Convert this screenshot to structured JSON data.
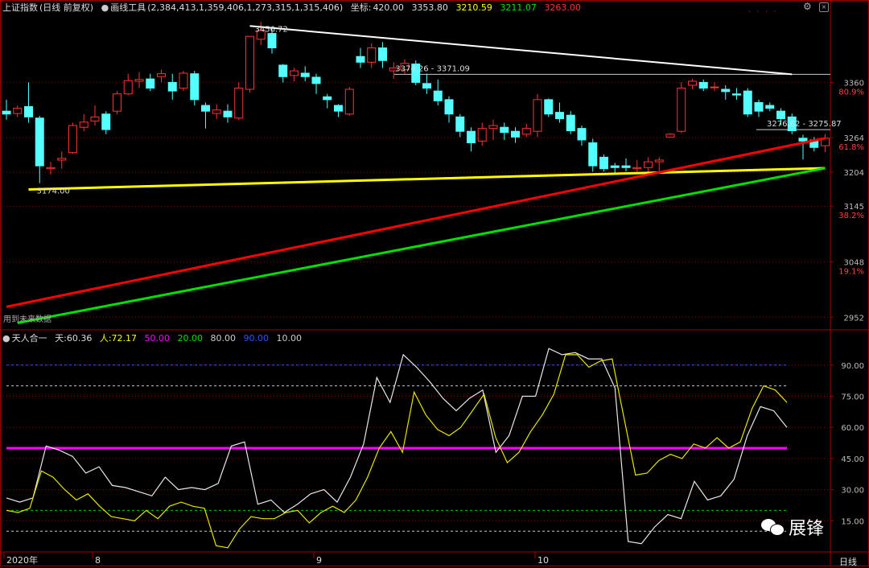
{
  "header": {
    "index_name": "上证指数",
    "index_mode": "(日线 前复权)",
    "tool_label": "画线工具",
    "tool_values": "(2,384,413,1,359,406,1,273,315,1,315,406)",
    "coord_label": "坐标:",
    "coord_value": "420.00",
    "v1": "3353.80",
    "v2": "3210.59",
    "v3": "3211.07",
    "v4": "3263.00"
  },
  "indicator_header": {
    "name": "天人合一",
    "tian_label": "天:",
    "tian_value": "60.36",
    "ren_label": "人:",
    "ren_value": "72.17",
    "l50": "50.00",
    "l20": "20.00",
    "l80": "80.00",
    "l90": "90.00",
    "l10": "10.00"
  },
  "annotations": {
    "high_label": "3456.72",
    "low_label": "3174.00",
    "white_line_label": "3374.26 - 3371.09",
    "red_line_label": "3276.62 - 3275.87",
    "future_label": "用到未来数据",
    "watermark": "展锋",
    "period": "日线"
  },
  "x_labels": [
    {
      "text": "2020年",
      "bar": 0
    },
    {
      "text": "8",
      "bar": 8
    },
    {
      "text": "9",
      "bar": 28
    },
    {
      "text": "10",
      "bar": 48
    }
  ],
  "colors": {
    "up": "#ff3232",
    "down": "#54ffff",
    "white_line": "#ffffff",
    "yellow_line": "#ffff00",
    "red_line": "#ff0000",
    "green_line": "#00e000",
    "magenta": "#ff00ff"
  },
  "chart_data": [
    {
      "type": "candlestick",
      "title": "上证指数",
      "y_ticks": [
        {
          "value": 3360,
          "label": "3360",
          "fib": "80.9%"
        },
        {
          "value": 3264,
          "label": "3264",
          "fib": "61.8%"
        },
        {
          "value": 3204,
          "label": "3204",
          "fib": ""
        },
        {
          "value": 3145,
          "label": "3145",
          "fib": "38.2%"
        },
        {
          "value": 3048,
          "label": "3048",
          "fib": "19.1%"
        },
        {
          "value": 2952,
          "label": "2952",
          "fib": ""
        }
      ],
      "ylim": [
        2930,
        3478
      ],
      "candles": [
        [
          3310,
          3305,
          3330,
          3295
        ],
        [
          3306,
          3315,
          3320,
          3300
        ],
        [
          3318,
          3300,
          3360,
          3290
        ],
        [
          3298,
          3215,
          3302,
          3185
        ],
        [
          3210,
          3212,
          3222,
          3200
        ],
        [
          3225,
          3228,
          3240,
          3210
        ],
        [
          3238,
          3285,
          3290,
          3236
        ],
        [
          3282,
          3291,
          3305,
          3275
        ],
        [
          3293,
          3300,
          3320,
          3285
        ],
        [
          3305,
          3278,
          3310,
          3270
        ],
        [
          3310,
          3340,
          3345,
          3305
        ],
        [
          3340,
          3363,
          3375,
          3338
        ],
        [
          3362,
          3365,
          3378,
          3350
        ],
        [
          3366,
          3350,
          3375,
          3345
        ],
        [
          3370,
          3375,
          3382,
          3360
        ],
        [
          3360,
          3345,
          3375,
          3330
        ],
        [
          3350,
          3376,
          3380,
          3345
        ],
        [
          3375,
          3330,
          3380,
          3320
        ],
        [
          3320,
          3310,
          3325,
          3280
        ],
        [
          3306,
          3312,
          3322,
          3296
        ],
        [
          3310,
          3300,
          3322,
          3290
        ],
        [
          3298,
          3350,
          3360,
          3295
        ],
        [
          3348,
          3440,
          3440,
          3342
        ],
        [
          3435,
          3450,
          3465,
          3425
        ],
        [
          3445,
          3420,
          3456,
          3410
        ],
        [
          3390,
          3370,
          3392,
          3360
        ],
        [
          3372,
          3380,
          3385,
          3362
        ],
        [
          3376,
          3370,
          3388,
          3362
        ],
        [
          3369,
          3358,
          3375,
          3340
        ],
        [
          3335,
          3330,
          3340,
          3315
        ],
        [
          3320,
          3310,
          3322,
          3300
        ],
        [
          3305,
          3348,
          3352,
          3302
        ],
        [
          3405,
          3395,
          3420,
          3385
        ],
        [
          3395,
          3420,
          3428,
          3385
        ],
        [
          3420,
          3398,
          3430,
          3385
        ],
        [
          3380,
          3385,
          3395,
          3366
        ],
        [
          3382,
          3393,
          3400,
          3375
        ],
        [
          3392,
          3360,
          3398,
          3355
        ],
        [
          3358,
          3350,
          3375,
          3340
        ],
        [
          3345,
          3328,
          3365,
          3320
        ],
        [
          3330,
          3305,
          3336,
          3290
        ],
        [
          3300,
          3275,
          3305,
          3265
        ],
        [
          3275,
          3255,
          3282,
          3240
        ],
        [
          3258,
          3280,
          3290,
          3250
        ],
        [
          3280,
          3285,
          3295,
          3260
        ],
        [
          3282,
          3273,
          3290,
          3260
        ],
        [
          3275,
          3265,
          3282,
          3255
        ],
        [
          3270,
          3280,
          3288,
          3265
        ],
        [
          3275,
          3330,
          3340,
          3265
        ],
        [
          3330,
          3305,
          3332,
          3300
        ],
        [
          3308,
          3297,
          3325,
          3290
        ],
        [
          3303,
          3276,
          3310,
          3270
        ],
        [
          3280,
          3260,
          3285,
          3250
        ],
        [
          3255,
          3215,
          3262,
          3205
        ],
        [
          3230,
          3210,
          3235,
          3205
        ],
        [
          3215,
          3212,
          3220,
          3200
        ],
        [
          3215,
          3212,
          3228,
          3205
        ],
        [
          3210,
          3212,
          3225,
          3205
        ],
        [
          3212,
          3222,
          3230,
          3200
        ],
        [
          3222,
          3225,
          3230,
          3205
        ],
        [
          3265,
          3270,
          3272,
          3264
        ],
        [
          3275,
          3350,
          3360,
          3272
        ],
        [
          3355,
          3362,
          3366,
          3348
        ],
        [
          3360,
          3350,
          3365,
          3345
        ],
        [
          3352,
          3352,
          3360,
          3345
        ],
        [
          3348,
          3344,
          3355,
          3330
        ],
        [
          3340,
          3338,
          3350,
          3330
        ],
        [
          3345,
          3305,
          3350,
          3300
        ],
        [
          3325,
          3310,
          3330,
          3300
        ],
        [
          3320,
          3315,
          3325,
          3310
        ],
        [
          3310,
          3297,
          3315,
          3285
        ],
        [
          3300,
          3276,
          3306,
          3270
        ],
        [
          3263,
          3258,
          3269,
          3226
        ],
        [
          3260,
          3247,
          3265,
          3240
        ],
        [
          3250,
          3263,
          3270,
          3239
        ]
      ],
      "lines": [
        {
          "name": "white",
          "points": [
            [
              3458,
              22
            ],
            [
              3374,
              71
            ]
          ]
        },
        {
          "name": "yellow",
          "points": [
            [
              3174,
              2
            ],
            [
              3211,
              74
            ]
          ]
        },
        {
          "name": "red",
          "points": [
            [
              2970,
              0
            ],
            [
              3263,
              74
            ]
          ]
        },
        {
          "name": "green",
          "points": [
            [
              2942,
              1
            ],
            [
              3211,
              74
            ]
          ]
        }
      ]
    },
    {
      "type": "line",
      "title": "天人合一",
      "y_ticks": [
        90,
        75,
        60,
        45,
        30,
        15
      ],
      "ylim": [
        0,
        100
      ],
      "series": [
        {
          "name": "天",
          "values": [
            26,
            24,
            26,
            51,
            49,
            46,
            38,
            41,
            32,
            31,
            29,
            27,
            36,
            30,
            31,
            30,
            33,
            51,
            53,
            23,
            25,
            19,
            23,
            28,
            30,
            24,
            36,
            52,
            84,
            72,
            95,
            89,
            82,
            74,
            68,
            74,
            78,
            48,
            56,
            75,
            75,
            98,
            95,
            96,
            93,
            93,
            79,
            5,
            4,
            12,
            18,
            16,
            34,
            25,
            27,
            35,
            56,
            70,
            68,
            60
          ]
        },
        {
          "name": "人",
          "values": [
            20,
            19,
            21,
            39,
            36,
            30,
            25,
            28,
            22,
            17,
            16,
            15,
            20,
            16,
            22,
            24,
            22,
            21,
            3,
            2,
            11,
            17,
            16,
            16,
            19,
            20,
            14,
            19,
            22,
            19,
            25,
            36,
            50,
            58,
            48,
            77,
            66,
            59,
            56,
            60,
            68,
            76,
            55,
            43,
            48,
            58,
            66,
            76,
            95,
            95,
            89,
            92,
            93,
            65,
            37,
            38,
            44,
            47,
            45,
            52,
            50,
            55,
            50,
            53,
            69,
            80,
            78,
            72
          ]
        }
      ],
      "hlines": [
        90,
        80,
        50,
        20,
        10
      ]
    }
  ]
}
